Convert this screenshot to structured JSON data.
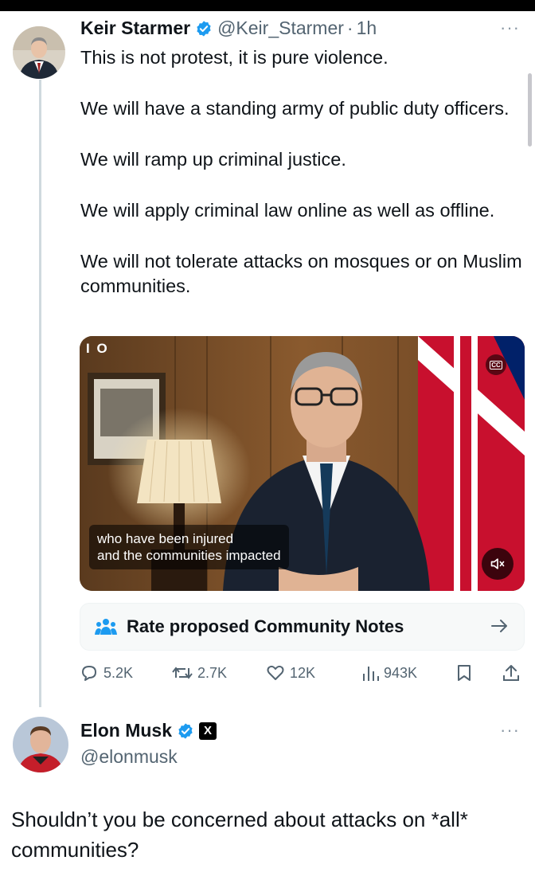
{
  "original_tweet": {
    "author_name": "Keir Starmer",
    "handle": "@Keir_Starmer",
    "separator": "·",
    "time": "1h",
    "more": "···",
    "paragraphs": [
      "This is not protest, it is pure violence.",
      "We will have a standing army of public duty officers.",
      "We will ramp up criminal justice.",
      "We will apply criminal law online as well as offline.",
      "We will not tolerate attacks on mosques or on Muslim communities."
    ],
    "video": {
      "logo": "I O",
      "caption_line1": "who have been injured",
      "caption_line2": "and the communities impacted",
      "cc_label": "CC"
    },
    "community_notes_label": "Rate proposed Community Notes",
    "stats": {
      "replies": "5.2K",
      "reposts": "2.7K",
      "likes": "12K",
      "views": "943K"
    }
  },
  "reply": {
    "author_name": "Elon Musk",
    "handle": "@elonmusk",
    "affiliate_badge": "X",
    "more": "···",
    "text": "Shouldn’t you be concerned about attacks on *all* communities?"
  },
  "colors": {
    "verified": "#1d9bf0",
    "text_primary": "#0f1419",
    "text_secondary": "#536471",
    "thread_line": "#cfd9de"
  }
}
